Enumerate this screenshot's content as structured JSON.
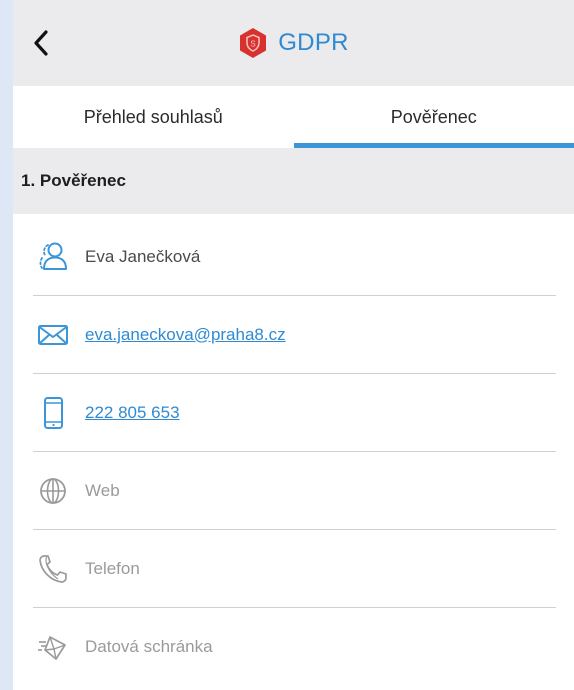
{
  "header": {
    "title": "GDPR",
    "back_icon": "chevron-left-icon",
    "logo_icon": "shield-hexagon-icon",
    "title_color": "#2f8ad1",
    "logo_color": "#d8322e"
  },
  "tabs": [
    {
      "label": "Přehled souhlasů",
      "active": false
    },
    {
      "label": "Pověřenec",
      "active": true
    }
  ],
  "section": {
    "title": "1. Pověřenec"
  },
  "contact": {
    "name": "Eva Janečková",
    "email": "eva.janeckova@praha8.cz",
    "phone": "222 805 653",
    "web": "Web",
    "telefon": "Telefon",
    "datova_schranka": "Datová schránka"
  },
  "colors": {
    "accent": "#2f8ad1",
    "tab_indicator": "#3b96d8",
    "muted": "#9a9a9a"
  }
}
